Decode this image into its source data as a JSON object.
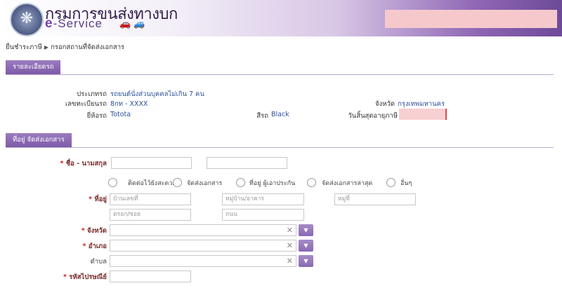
{
  "header": {
    "department": "กรมการขนส่งทางบก",
    "eservice_prefix": "e",
    "eservice_suffix": "-Service",
    "logo_icon": "department-seal-icon",
    "accent": "#7c3fb4"
  },
  "breadcrumb": {
    "item1": "ยื่นชำระภาษี",
    "item2": "กรอกสถานที่จัดส่งเอกสาร"
  },
  "vehicle_section": {
    "title": "รายละเอียดรถ",
    "type_label": "ประเภทรถ",
    "type_value": "รถยนต์นั่งส่วนบุคคลไม่เกิน 7 คน",
    "plate_label": "เลขทะเบียนรถ",
    "plate_value": "8กท - XXXX",
    "province_label": "จังหวัด",
    "province_value": "กรุงเทพมหานคร",
    "brand_label": "ยี่ห้อรถ",
    "brand_value": "Totota",
    "color_label": "สีรถ",
    "color_value": "Black",
    "expiry_label": "วันสิ้นสุดอายุภาษี"
  },
  "address_section": {
    "title": "ที่อยู่ จัดส่งเอกสาร",
    "name_label": "ชื่อ - นามสกุล",
    "address_type_options": [
      "ติดต่อไว้ยังสะดวก",
      "จัดส่งเอกสาร",
      "ที่อยู่ ผู้เอาประกัน",
      "จัดส่งเอกสารล่าสุด",
      "อื่นๆ"
    ],
    "address_label": "ที่อยู่",
    "house_no_placeholder": "บ้านเลขที่",
    "village_placeholder": "หมู่บ้าน/อาคาร",
    "moo_placeholder": "หมู่ที่",
    "soi_placeholder": "ตรอก/ซอย",
    "road_placeholder": "ถนน",
    "province_label": "จังหวัด",
    "district_label": "อำเภอ",
    "subdistrict_label": "ตำบล",
    "postcode_label": "รหัสไปรษณีย์",
    "required_mark": "*",
    "clear_glyph": "✕",
    "dropdown_glyph": "▼"
  }
}
